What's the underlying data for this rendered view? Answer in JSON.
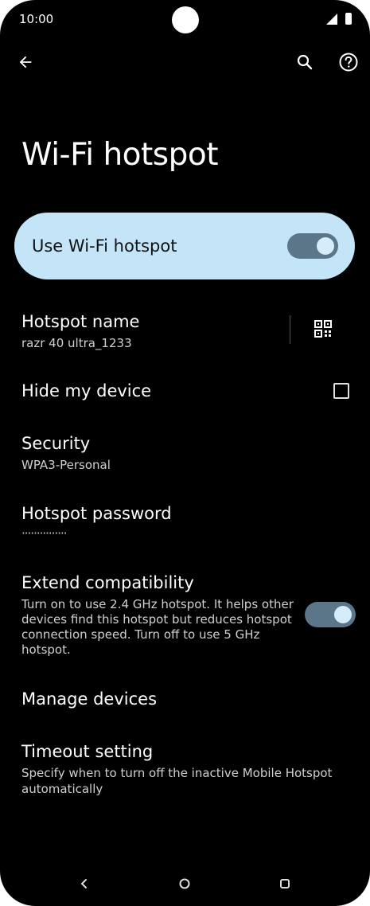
{
  "status_bar": {
    "time": "10:00"
  },
  "app_bar": {
    "back_icon": "arrow-back-icon",
    "search_icon": "search-icon",
    "help_icon": "help-circle-icon"
  },
  "page": {
    "title": "Wi-Fi hotspot"
  },
  "main_toggle": {
    "label": "Use Wi-Fi hotspot",
    "on": true,
    "accent": "#c4e4f8"
  },
  "settings": {
    "hotspot_name": {
      "title": "Hotspot name",
      "value": "razr 40 ultra_1233"
    },
    "hide_device": {
      "title": "Hide my device",
      "checked": false
    },
    "security": {
      "title": "Security",
      "value": "WPA3-Personal"
    },
    "password": {
      "title": "Hotspot password",
      "value": "···············"
    },
    "extend": {
      "title": "Extend compatibility",
      "line1": "Turn on to use 2.4 GHz hotspot. It helps other",
      "line2": "devices find this hotspot but reduces hotspot",
      "line3": "connection speed. Turn off to use 5 GHz",
      "line4": "hotspot.",
      "on": true
    },
    "manage": {
      "title": "Manage devices"
    },
    "timeout": {
      "title": "Timeout setting",
      "line1": "Specify when to turn off the inactive Mobile Hotspot",
      "line2": "automatically"
    }
  },
  "nav_bar": {
    "back": "nav-back-icon",
    "home": "nav-home-icon",
    "recents": "nav-recents-icon"
  }
}
